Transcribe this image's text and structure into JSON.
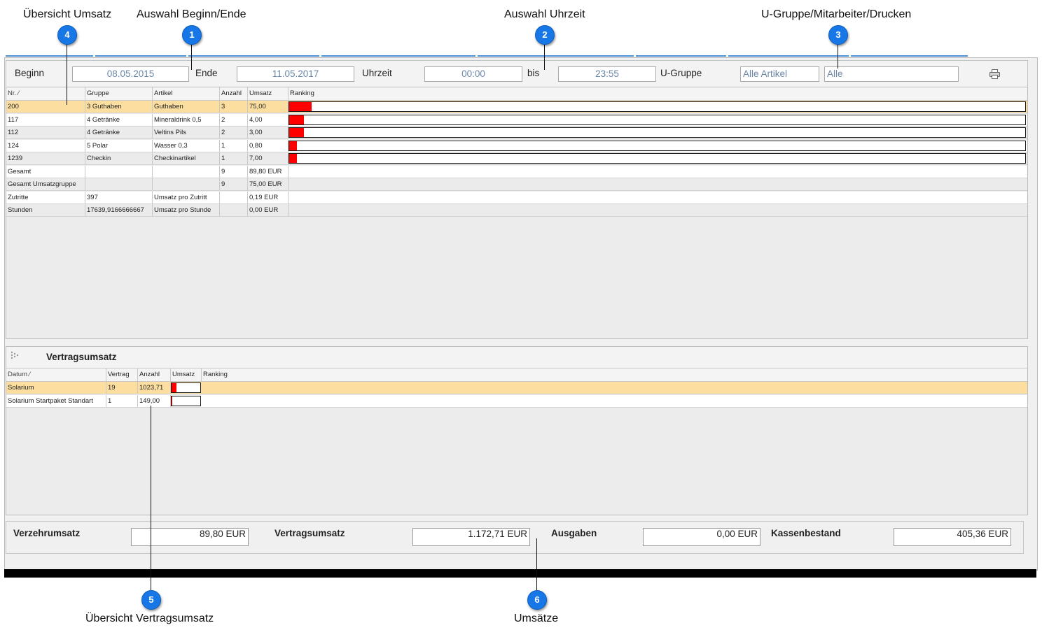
{
  "callouts": [
    {
      "num": "4",
      "title": "Übersicht Umsatz"
    },
    {
      "num": "1",
      "title": "Auswahl Beginn/Ende"
    },
    {
      "num": "2",
      "title": "Auswahl Uhrzeit"
    },
    {
      "num": "3",
      "title": "U-Gruppe/Mitarbeiter/Drucken"
    },
    {
      "num": "5",
      "title": "Übersicht Vertragsumsatz"
    },
    {
      "num": "6",
      "title": "Umsätze"
    }
  ],
  "filter": {
    "beginn_label": "Beginn",
    "beginn_value": "08.05.2015",
    "ende_label": "Ende",
    "ende_value": "11.05.2017",
    "uhrzeit_label": "Uhrzeit",
    "uhrzeit_from": "00:00",
    "bis_label": "bis",
    "uhrzeit_to": "23:55",
    "ugruppe_label": "U-Gruppe",
    "ugruppe_value": "Alle Artikel",
    "mitarbeiter_value": "Alle",
    "print_icon": "printer-icon"
  },
  "umsatz_table": {
    "headers": [
      "Nr. ⁄",
      "Gruppe",
      "Artikel",
      "Anzahl",
      "Umsatz",
      "Ranking"
    ],
    "rows": [
      {
        "nr": "200",
        "gruppe": "3 Guthaben",
        "artikel": "Guthaben",
        "anzahl": "3",
        "umsatz": "75,00",
        "ranking": 0.03
      },
      {
        "nr": "117",
        "gruppe": "4 Getränke",
        "artikel": "Mineraldrink 0,5",
        "anzahl": "2",
        "umsatz": "4,00",
        "ranking": 0.02
      },
      {
        "nr": "112",
        "gruppe": "4 Getränke",
        "artikel": "Veltins Pils",
        "anzahl": "2",
        "umsatz": "3,00",
        "ranking": 0.02
      },
      {
        "nr": "124",
        "gruppe": "5 Polar",
        "artikel": "Wasser 0,3",
        "anzahl": "1",
        "umsatz": "0,80",
        "ranking": 0.01
      },
      {
        "nr": "1239",
        "gruppe": "Checkin",
        "artikel": "Checkinartikel",
        "anzahl": "1",
        "umsatz": "7,00",
        "ranking": 0.01
      }
    ],
    "summary_rows": [
      {
        "nr": "Gesamt",
        "gruppe": "",
        "artikel": "",
        "anzahl": "9",
        "umsatz": "89,80 EUR"
      },
      {
        "nr": "Gesamt Umsatzgruppe",
        "gruppe": "",
        "artikel": "",
        "anzahl": "9",
        "umsatz": "75,00 EUR"
      },
      {
        "nr": "Zutritte",
        "gruppe": "397",
        "artikel": "Umsatz pro Zutritt",
        "anzahl": "",
        "umsatz": "0,19 EUR"
      },
      {
        "nr": "Stunden",
        "gruppe": "17639,9166666667",
        "artikel": "Umsatz pro Stunde",
        "anzahl": "",
        "umsatz": "0,00 EUR"
      }
    ]
  },
  "vertrag_panel": {
    "title": "Vertragsumsatz",
    "headers": [
      "Datum ⁄",
      "Vertrag",
      "Anzahl",
      "Umsatz",
      "Ranking"
    ],
    "rows": [
      {
        "datum": "Solarium",
        "vertrag": "19",
        "anzahl": "1023,71",
        "ranking": 0.18
      },
      {
        "datum": "Solarium Startpaket Standart",
        "vertrag": "1",
        "anzahl": "149,00",
        "ranking": 0.03
      }
    ]
  },
  "totals": {
    "verzehr_label": "Verzehrumsatz",
    "verzehr_value": "89,80 EUR",
    "vertrag_label": "Vertragsumsatz",
    "vertrag_value": "1.172,71 EUR",
    "ausgaben_label": "Ausgaben",
    "ausgaben_value": "0,00 EUR",
    "kasse_label": "Kassenbestand",
    "kasse_value": "405,36 EUR"
  },
  "colors": {
    "accent": "#1877e6",
    "bar": "#ff0000",
    "selected_row": "#fbdea0"
  }
}
